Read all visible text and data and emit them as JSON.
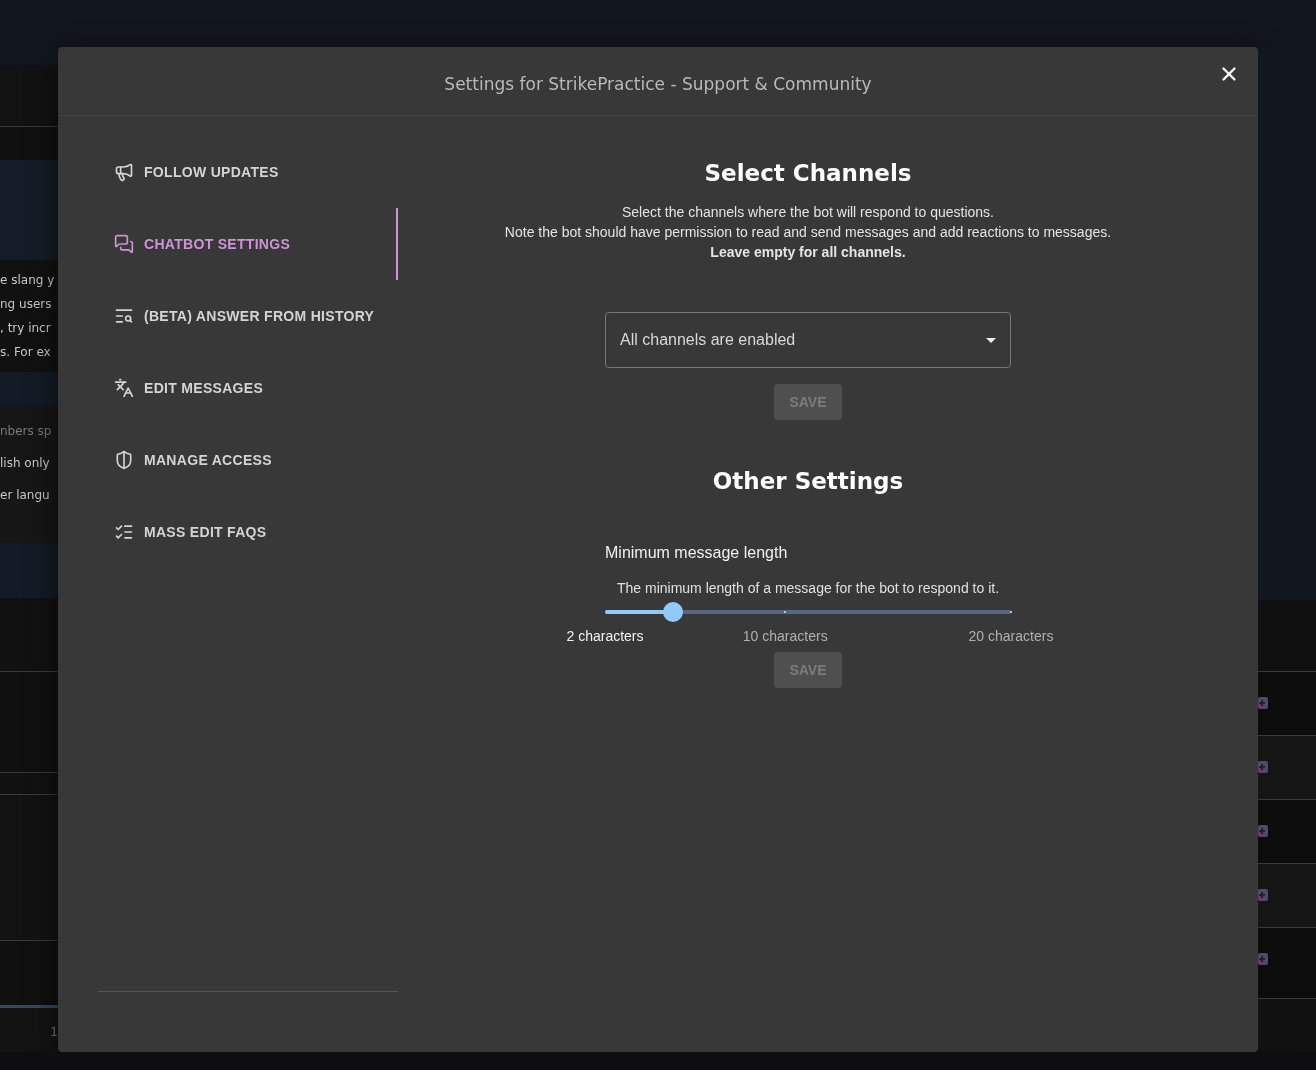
{
  "background": {
    "left_fragments": [
      {
        "text": "e slang y",
        "muted": false
      },
      {
        "text": "ng users",
        "muted": false
      },
      {
        "text": ", try incr",
        "muted": false
      },
      {
        "text": "s. For ex",
        "muted": false
      }
    ],
    "left_fragments_2": [
      {
        "text": "nbers sp",
        "muted": true
      },
      {
        "text": "lish only",
        "muted": false
      },
      {
        "text": "er langu",
        "muted": false
      }
    ],
    "footer_fragment": "1"
  },
  "dialog": {
    "title": "Settings for StrikePractice - Support & Community"
  },
  "sidebar": {
    "items": [
      {
        "label": "FOLLOW UPDATES",
        "selected": false
      },
      {
        "label": "CHATBOT SETTINGS",
        "selected": true
      },
      {
        "label": "(BETA) ANSWER FROM HISTORY",
        "selected": false
      },
      {
        "label": "EDIT MESSAGES",
        "selected": false
      },
      {
        "label": "MANAGE ACCESS",
        "selected": false
      },
      {
        "label": "MASS EDIT FAQS",
        "selected": false
      }
    ]
  },
  "select_channels": {
    "title": "Select Channels",
    "description": [
      "Select the channels where the bot will respond to questions.",
      "Note the bot should have permission to read and send messages and add reactions to messages."
    ],
    "note": "Leave empty for all channels.",
    "select": {
      "value": "All channels are enabled"
    },
    "save": {
      "label": "SAVE",
      "disabled": true
    }
  },
  "other_settings": {
    "title": "Other Settings",
    "setting": {
      "label": "Minimum message length",
      "description": "The minimum length of a message for the bot to respond to it.",
      "slider": {
        "level": 0.167,
        "marks": [
          {
            "label": "2 characters",
            "active": true
          },
          {
            "label": "10 characters",
            "active": false
          },
          {
            "label": "20 characters",
            "active": false
          }
        ]
      }
    },
    "save": {
      "label": "SAVE",
      "disabled": true
    }
  }
}
